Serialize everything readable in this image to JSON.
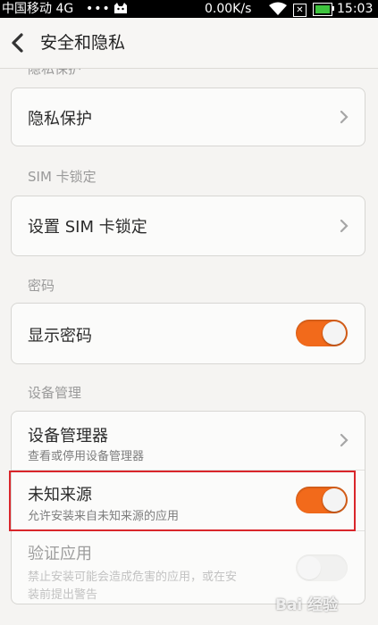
{
  "status_bar": {
    "carrier": "中国移动 4G",
    "dots": "•••",
    "speed": "0.00K/s",
    "time": "15:03",
    "icons": [
      "cat-icon",
      "wifi-icon",
      "sim-x-icon",
      "battery-icon"
    ]
  },
  "header": {
    "title": "安全和隐私",
    "back_icon": "chevron-left-icon"
  },
  "sections": {
    "privacy": {
      "label": "隐私保护",
      "items": [
        {
          "title": "隐私保护",
          "control": "chevron"
        }
      ]
    },
    "sim_lock": {
      "label": "SIM 卡锁定",
      "items": [
        {
          "title": "设置 SIM 卡锁定",
          "control": "chevron"
        }
      ]
    },
    "password": {
      "label": "密码",
      "items": [
        {
          "title": "显示密码",
          "control": "toggle",
          "on": true
        }
      ]
    },
    "device_admin": {
      "label": "设备管理",
      "items": [
        {
          "title": "设备管理器",
          "subtitle": "查看或停用设备管理器",
          "control": "chevron"
        },
        {
          "title": "未知来源",
          "subtitle": "允许安装来自未知来源的应用",
          "control": "toggle",
          "on": true
        },
        {
          "title": "验证应用",
          "subtitle_line1": "禁止安装可能会造成危害的应用，或在安",
          "subtitle_line2": "装前提出警告",
          "control": "toggle",
          "on": false,
          "disabled": true
        }
      ]
    }
  },
  "colors": {
    "accent": "#f26a1b",
    "highlight": "#d9262b",
    "statusbar": "#000000"
  },
  "watermark": "Bai 经验"
}
